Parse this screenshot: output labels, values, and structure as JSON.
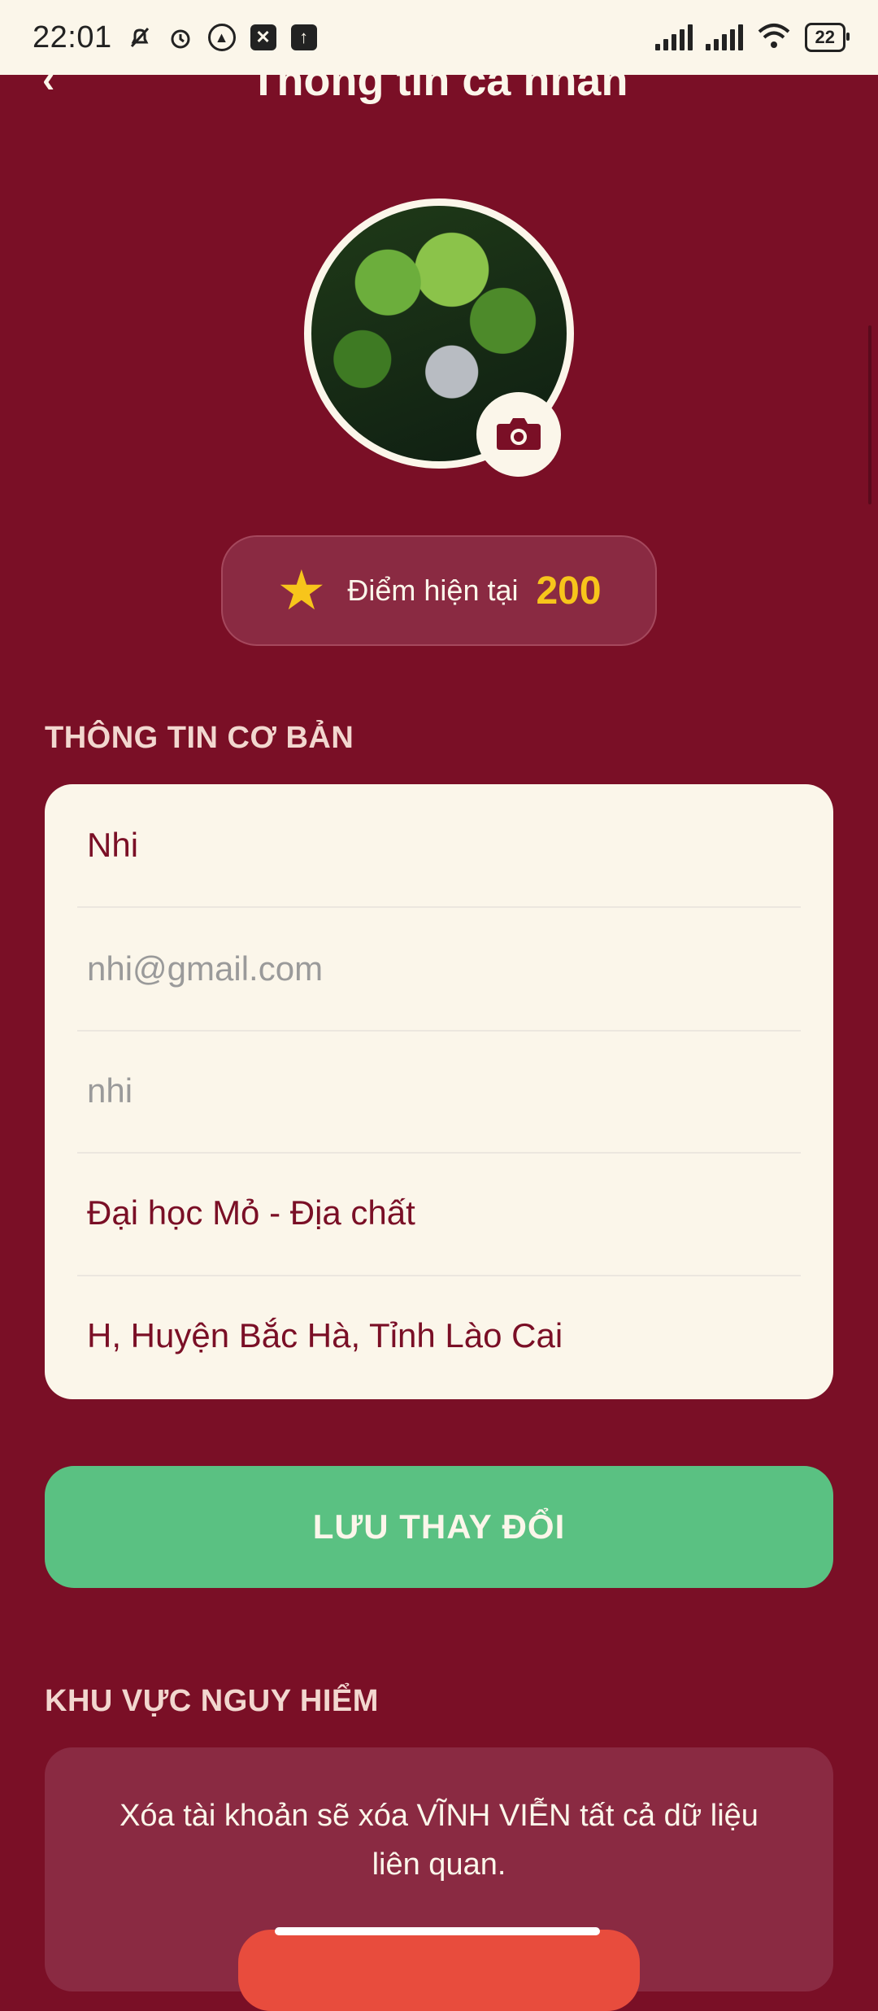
{
  "status_bar": {
    "time": "22:01",
    "battery": "22",
    "icons": [
      "bell-off-icon",
      "alarm-icon",
      "app-icon",
      "app-icon-2",
      "upload-icon",
      "signal-icon",
      "signal-icon-2",
      "wifi-icon"
    ]
  },
  "header": {
    "title": "Thông tin cá nhân",
    "back_icon": "chevron-left-icon"
  },
  "profile": {
    "camera_icon": "camera-icon",
    "points_label": "Điểm hiện tại",
    "points_value": "200"
  },
  "basic_info": {
    "section_title": "THÔNG TIN CƠ BẢN",
    "fields": [
      {
        "value": "Nhi",
        "placeholder": false
      },
      {
        "value": "nhi@gmail.com",
        "placeholder": true
      },
      {
        "value": "nhi",
        "placeholder": true
      },
      {
        "value": "Đại học Mỏ - Địa chất",
        "placeholder": false
      },
      {
        "value": "H, Huyện Bắc Hà, Tỉnh Lào Cai",
        "placeholder": false
      }
    ]
  },
  "save_button": "LƯU THAY ĐỔI",
  "danger_zone": {
    "section_title": "KHU VỰC NGUY HIỂM",
    "text": "Xóa tài khoản sẽ xóa VĨNH VIỄN tất cả dữ liệu liên quan."
  },
  "colors": {
    "background": "#7a0f26",
    "card": "#fbf6ea",
    "accent_green": "#5ac182",
    "points_yellow": "#f7c51b",
    "danger_red": "#e84c3d"
  }
}
